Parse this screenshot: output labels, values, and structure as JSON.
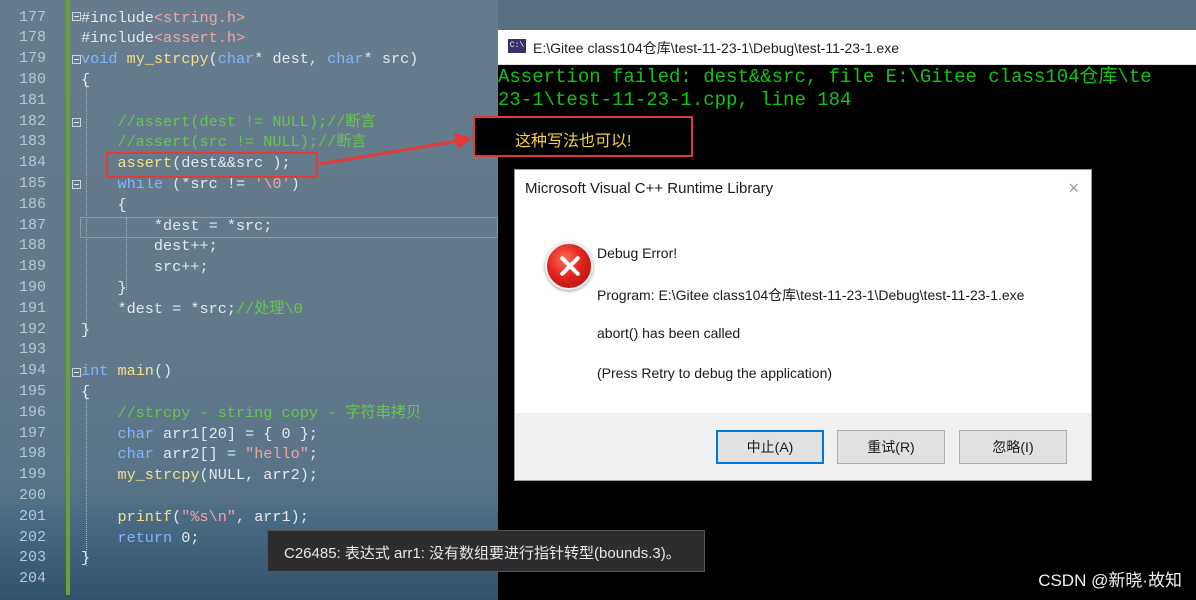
{
  "editor": {
    "lines": [
      {
        "num": "177",
        "segs": [
          {
            "t": "#include",
            "c": ""
          },
          {
            "t": "<string.h>",
            "c": "str"
          }
        ]
      },
      {
        "num": "178",
        "segs": [
          {
            "t": "#include",
            "c": ""
          },
          {
            "t": "<assert.h>",
            "c": "str"
          }
        ]
      },
      {
        "num": "179",
        "segs": [
          {
            "t": "void",
            "c": "kw"
          },
          {
            "t": " ",
            "c": ""
          },
          {
            "t": "my_strcpy",
            "c": "fn"
          },
          {
            "t": "(",
            "c": ""
          },
          {
            "t": "char",
            "c": "kw"
          },
          {
            "t": "* dest, ",
            "c": ""
          },
          {
            "t": "char",
            "c": "kw"
          },
          {
            "t": "* src)",
            "c": ""
          }
        ]
      },
      {
        "num": "180",
        "segs": [
          {
            "t": "{",
            "c": ""
          }
        ]
      },
      {
        "num": "181",
        "segs": [
          {
            "t": "",
            "c": ""
          }
        ]
      },
      {
        "num": "182",
        "segs": [
          {
            "t": "    //assert(dest != NULL);//断言",
            "c": "cm"
          }
        ]
      },
      {
        "num": "183",
        "segs": [
          {
            "t": "    //assert(src != NULL);//断言",
            "c": "cm"
          }
        ]
      },
      {
        "num": "184",
        "segs": [
          {
            "t": "    ",
            "c": ""
          },
          {
            "t": "assert",
            "c": "fn"
          },
          {
            "t": "(dest&&src );",
            "c": ""
          }
        ]
      },
      {
        "num": "185",
        "segs": [
          {
            "t": "    ",
            "c": ""
          },
          {
            "t": "while",
            "c": "kw"
          },
          {
            "t": " (*src != ",
            "c": ""
          },
          {
            "t": "'\\0'",
            "c": "str"
          },
          {
            "t": ")",
            "c": ""
          }
        ]
      },
      {
        "num": "186",
        "segs": [
          {
            "t": "    {",
            "c": ""
          }
        ]
      },
      {
        "num": "187",
        "segs": [
          {
            "t": "        *dest = *src;",
            "c": ""
          }
        ]
      },
      {
        "num": "188",
        "segs": [
          {
            "t": "        dest++;",
            "c": ""
          }
        ]
      },
      {
        "num": "189",
        "segs": [
          {
            "t": "        src++;",
            "c": ""
          }
        ]
      },
      {
        "num": "190",
        "segs": [
          {
            "t": "    }",
            "c": ""
          }
        ]
      },
      {
        "num": "191",
        "segs": [
          {
            "t": "    *dest = *src;",
            "c": ""
          },
          {
            "t": "//处理\\0",
            "c": "cm"
          }
        ]
      },
      {
        "num": "192",
        "segs": [
          {
            "t": "}",
            "c": ""
          }
        ]
      },
      {
        "num": "193",
        "segs": [
          {
            "t": "",
            "c": ""
          }
        ]
      },
      {
        "num": "194",
        "segs": [
          {
            "t": "int",
            "c": "kw"
          },
          {
            "t": " ",
            "c": ""
          },
          {
            "t": "main",
            "c": "fn"
          },
          {
            "t": "()",
            "c": ""
          }
        ]
      },
      {
        "num": "195",
        "segs": [
          {
            "t": "{",
            "c": ""
          }
        ]
      },
      {
        "num": "196",
        "segs": [
          {
            "t": "    //strcpy - string copy - 字符串拷贝",
            "c": "cm"
          }
        ]
      },
      {
        "num": "197",
        "segs": [
          {
            "t": "    ",
            "c": ""
          },
          {
            "t": "char",
            "c": "kw"
          },
          {
            "t": " arr1[20] = { 0 };",
            "c": ""
          }
        ]
      },
      {
        "num": "198",
        "segs": [
          {
            "t": "    ",
            "c": ""
          },
          {
            "t": "char",
            "c": "kw"
          },
          {
            "t": " arr2[] = ",
            "c": ""
          },
          {
            "t": "\"hello\"",
            "c": "str"
          },
          {
            "t": ";",
            "c": ""
          }
        ]
      },
      {
        "num": "199",
        "segs": [
          {
            "t": "    ",
            "c": ""
          },
          {
            "t": "my_strcpy",
            "c": "fn"
          },
          {
            "t": "(NULL, arr2);",
            "c": ""
          }
        ]
      },
      {
        "num": "200",
        "segs": [
          {
            "t": "",
            "c": ""
          }
        ]
      },
      {
        "num": "201",
        "segs": [
          {
            "t": "    ",
            "c": ""
          },
          {
            "t": "printf",
            "c": "fn"
          },
          {
            "t": "(",
            "c": ""
          },
          {
            "t": "\"%s\\n\"",
            "c": "str"
          },
          {
            "t": ", arr1);",
            "c": ""
          }
        ]
      },
      {
        "num": "202",
        "segs": [
          {
            "t": "    ",
            "c": ""
          },
          {
            "t": "return",
            "c": "kw"
          },
          {
            "t": " 0;",
            "c": ""
          }
        ]
      },
      {
        "num": "203",
        "segs": [
          {
            "t": "}",
            "c": ""
          }
        ]
      },
      {
        "num": "204",
        "segs": [
          {
            "t": "",
            "c": ""
          }
        ]
      }
    ]
  },
  "console": {
    "title": "E:\\Gitee class104仓库\\test-11-23-1\\Debug\\test-11-23-1.exe",
    "icon_label": "C:\\",
    "line1": "Assertion failed: dest&&src, file E:\\Gitee class104仓库\\te",
    "line2": "23-1\\test-11-23-1.cpp, line 184"
  },
  "annotation": {
    "text": "这种写法也可以!"
  },
  "dialog": {
    "title": "Microsoft Visual C++ Runtime Library",
    "close": "×",
    "heading": "Debug Error!",
    "program": "Program: E:\\Gitee class104仓库\\test-11-23-1\\Debug\\test-11-23-1.exe",
    "abort": "abort() has been called",
    "hint": "(Press Retry to debug the application)",
    "buttons": {
      "abort": "中止(A)",
      "retry": "重试(R)",
      "ignore": "忽略(I)"
    }
  },
  "tooltip": {
    "text": "C26485: 表达式 arr1: 没有数组要进行指针转型(bounds.3)。"
  },
  "watermark": "CSDN @新晓·故知",
  "colors": {
    "keyword": "#7fb6ff",
    "comment": "#66c64f",
    "string": "#f4a3a3",
    "console_text": "#13c313",
    "annotation_border": "#e53935",
    "annotation_text": "#f5d33b"
  }
}
